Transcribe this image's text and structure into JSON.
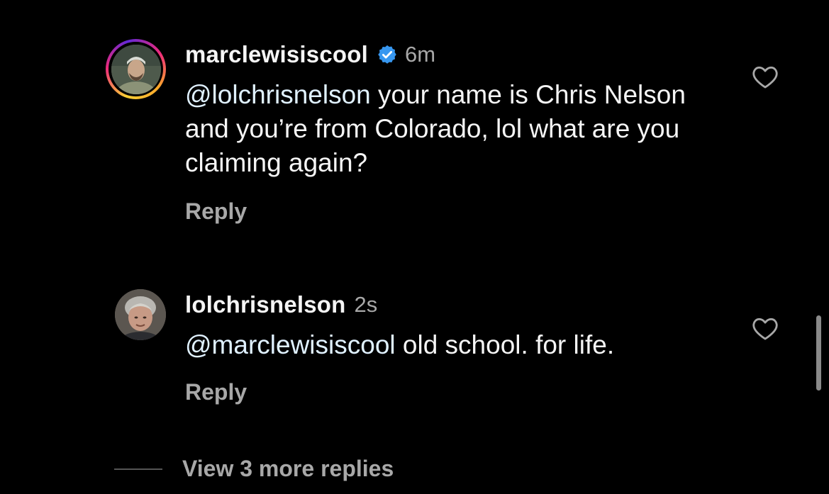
{
  "comments": [
    {
      "username": "marclewisiscool",
      "verified": true,
      "time": "6m",
      "mention": "@lolchrisnelson",
      "text": " your name is Chris Nelson and you’re from Colorado, lol what are you claiming again?",
      "reply_label": "Reply",
      "avatar_icon": "user-avatar-story-ring",
      "like_icon": "heart-outline-icon"
    },
    {
      "username": "lolchrisnelson",
      "verified": false,
      "time": "2s",
      "mention": "@marclewisiscool",
      "text": " old school. for life.",
      "reply_label": "Reply",
      "avatar_icon": "user-avatar",
      "like_icon": "heart-outline-icon"
    }
  ],
  "view_more_replies": "View 3 more replies",
  "colors": {
    "background": "#000000",
    "text_primary": "#f5f5f5",
    "text_secondary": "#a8a8a8",
    "verified_blue": "#3797f0",
    "mention": "#e0f1ff"
  }
}
